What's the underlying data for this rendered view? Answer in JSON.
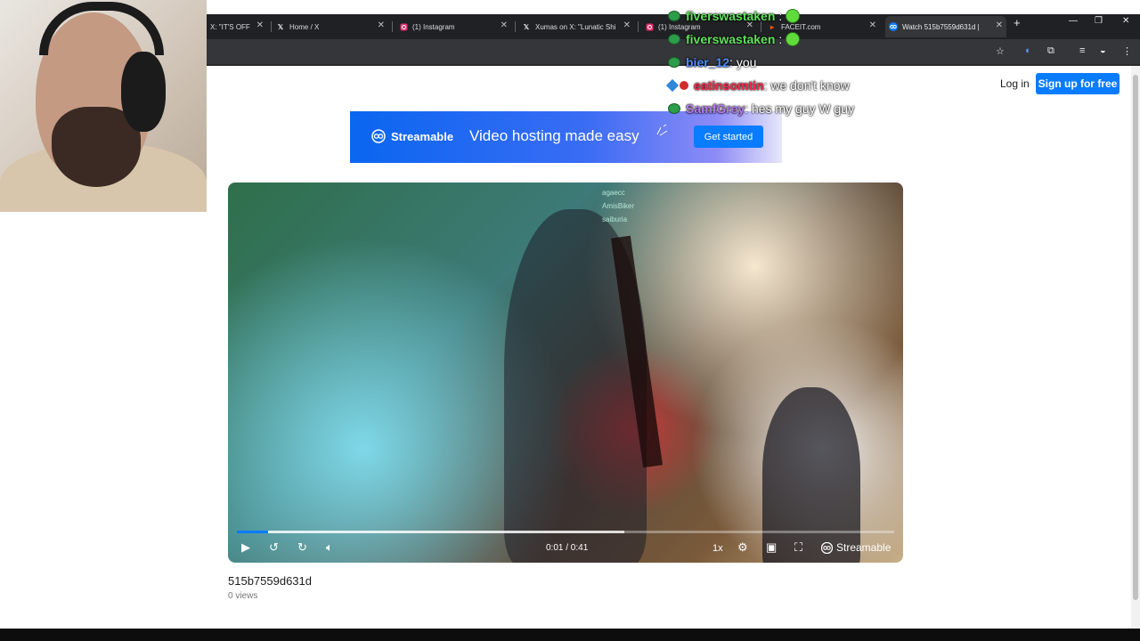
{
  "browser": {
    "tabs": [
      {
        "title": "X: \"IT'S OFF",
        "icon": "x-logo-icon"
      },
      {
        "title": "Home / X",
        "icon": "x-logo-icon"
      },
      {
        "title": "(1) Instagram",
        "icon": "instagram-icon"
      },
      {
        "title": "Xumas on X: \"Lunatic Shi",
        "icon": "x-logo-icon"
      },
      {
        "title": "(1) Instagram",
        "icon": "instagram-icon"
      },
      {
        "title": "FACEIT.com",
        "icon": "faceit-icon"
      },
      {
        "title": "Watch 515b7559d631d |",
        "icon": "streamable-icon",
        "active": true
      }
    ],
    "new_tab": "+"
  },
  "header": {
    "login": "Log in",
    "signup": "Sign up for free"
  },
  "banner": {
    "brand": "Streamable",
    "tagline": "Video hosting made easy",
    "cta": "Get started"
  },
  "player": {
    "time": "0:01 / 0:41",
    "speed": "1x",
    "brand": "Streamable",
    "progress_played": 0.048,
    "progress_buffered": 0.59
  },
  "video": {
    "title": "515b7559d631d",
    "views": "0 views"
  },
  "chat": [
    {
      "user": "fiverswastaken",
      "color": "#5fe05a",
      "text": ":",
      "emote": true
    },
    {
      "user": "fiverswastaken",
      "color": "#5fe05a",
      "text": ":",
      "emote": true
    },
    {
      "user": "bier_12",
      "color": "#4f8bff",
      "text": ": you",
      "emote": false
    },
    {
      "user": "eatinsomtin",
      "color": "#ff2a4a",
      "text": ": we don't know",
      "emote": false
    },
    {
      "user": "SamfGrey",
      "color": "#b37bf0",
      "text": ": hes my guy W guy",
      "emote": false
    }
  ],
  "video_chat": [
    "agaecc",
    "AmisBiker",
    "saiburia"
  ]
}
